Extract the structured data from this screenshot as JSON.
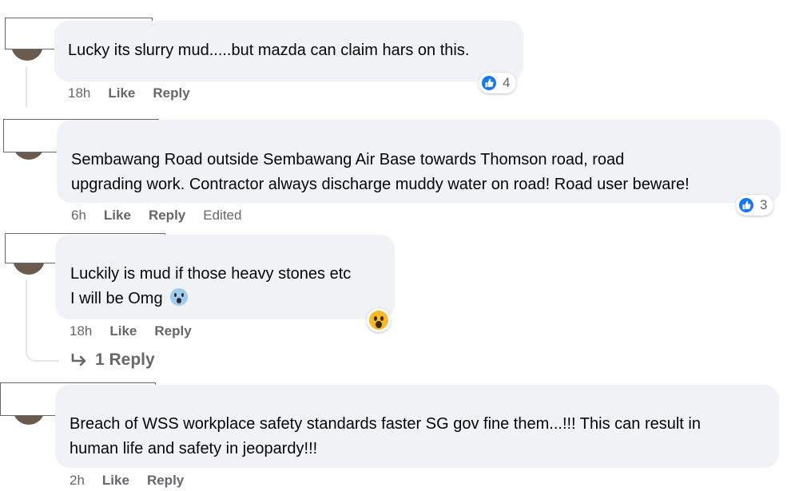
{
  "comments": [
    {
      "lines": [
        "Lucky its slurry mud.....but mazda can claim hars on this."
      ],
      "time": "18h",
      "like_label": "Like",
      "reply_label": "Reply",
      "reaction_icon": "like-icon",
      "reaction_count": "4"
    },
    {
      "lines": [
        "Sembawang Road outside Sembawang Air Base towards Thomson road, road",
        "upgrading work. Contractor always discharge muddy water on road! Road user beware!"
      ],
      "time": "6h",
      "like_label": "Like",
      "reply_label": "Reply",
      "edited_label": "Edited",
      "reaction_icon": "like-icon",
      "reaction_count": "3"
    },
    {
      "lines": [
        "Luckily is mud if those heavy stones etc",
        "I will be Omg"
      ],
      "emoji": "screaming-face-emoji",
      "time": "18h",
      "like_label": "Like",
      "reply_label": "Reply",
      "reaction_icon": "wow-icon",
      "replies_label": "1 Reply"
    },
    {
      "lines": [
        "Breach of WSS workplace safety standards faster SG gov fine them...!!! This can result in",
        "human life and safety in jeopardy!!!"
      ],
      "time": "2h",
      "like_label": "Like",
      "reply_label": "Reply"
    }
  ],
  "colors": {
    "bubble_bg": "#f0f2f5",
    "meta_text": "#65676b",
    "like_blue": "#1877f2",
    "wow_yellow": "#f7b928"
  }
}
